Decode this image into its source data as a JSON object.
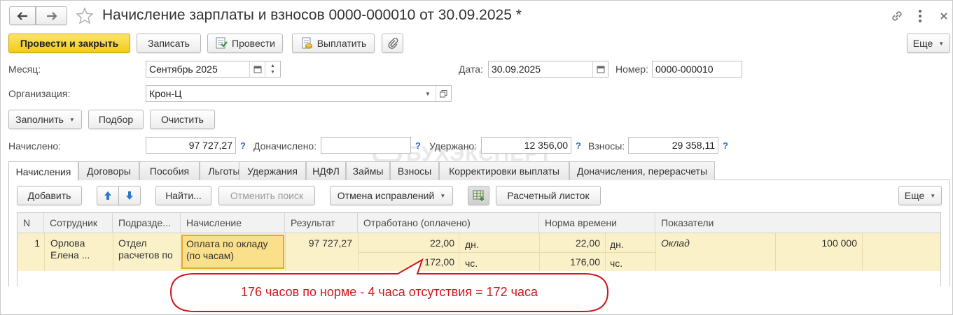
{
  "window": {
    "title": "Начисление зарплаты и взносов 0000-000010 от 30.09.2025 *"
  },
  "toolbar": {
    "post_close": "Провести и закрыть",
    "save": "Записать",
    "post": "Провести",
    "pay": "Выплатить",
    "more": "Еще"
  },
  "header": {
    "month_label": "Месяц:",
    "month_value": "Сентябрь 2025",
    "date_label": "Дата:",
    "date_value": "30.09.2025",
    "number_label": "Номер:",
    "number_value": "0000-000010",
    "org_label": "Организация:",
    "org_value": "Крон-Ц"
  },
  "actions": {
    "fill": "Заполнить",
    "select": "Подбор",
    "clear": "Очистить"
  },
  "totals": {
    "accrued_label": "Начислено:",
    "accrued_value": "97 727,27",
    "extra_label": "Доначислено:",
    "extra_value": "",
    "withheld_label": "Удержано:",
    "withheld_value": "12 356,00",
    "contrib_label": "Взносы:",
    "contrib_value": "29 358,11",
    "help": "?"
  },
  "tabs": [
    {
      "label": "Начисления"
    },
    {
      "label": "Договоры"
    },
    {
      "label": "Пособия"
    },
    {
      "label": "Льготы"
    },
    {
      "label": "Удержания"
    },
    {
      "label": "НДФЛ"
    },
    {
      "label": "Займы"
    },
    {
      "label": "Взносы"
    },
    {
      "label": "Корректировки выплаты"
    },
    {
      "label": "Доначисления, перерасчеты"
    }
  ],
  "tab_toolbar": {
    "add": "Добавить",
    "find": "Найти...",
    "cancel_search": "Отменить поиск",
    "cancel_fixes": "Отмена исправлений",
    "payslip": "Расчетный листок",
    "more": "Еще"
  },
  "table": {
    "headers": [
      "N",
      "Сотрудник",
      "Подразде...",
      "Начисление",
      "Результат",
      "Отработано (оплачено)",
      "Норма времени",
      "Показатели"
    ],
    "row": {
      "n": "1",
      "employee_line1": "Орлова",
      "employee_line2": "Елена ...",
      "dept_line1": "Отдел",
      "dept_line2": "расчетов по",
      "accrual_line1": "Оплата по окладу",
      "accrual_line2": "(по часам)",
      "result": "97 727,27",
      "worked_days": "22,00",
      "worked_days_unit": "дн.",
      "worked_hours": "172,00",
      "worked_hours_unit": "чс.",
      "norm_days": "22,00",
      "norm_days_unit": "дн.",
      "norm_hours": "176,00",
      "norm_hours_unit": "чс.",
      "indicator_name": "Оклад",
      "indicator_value": "100 000"
    }
  },
  "callout": {
    "text": "176 часов по норме - 4 часа отсутствия = 172 часа",
    "color": "#d0161c"
  },
  "watermark": {
    "text": "БУХЭКСПЕРТ"
  },
  "colors": {
    "primary_button": "#f2cc17",
    "selected_row": "#fbf1c8",
    "current_cell": "#fbe08c",
    "help_mark": "#2a6bc4"
  }
}
